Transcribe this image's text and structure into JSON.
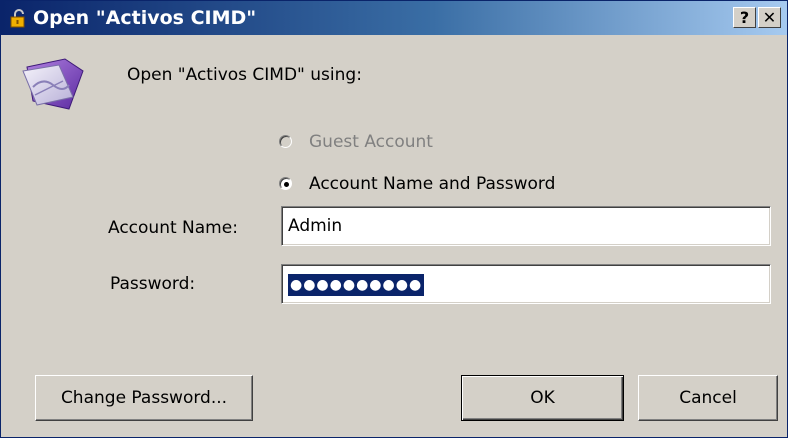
{
  "window": {
    "title": "Open \"Activos CIMD\"",
    "help_label": "?",
    "close_label": "✕"
  },
  "dialog": {
    "prompt": "Open \"Activos CIMD\" using:",
    "options": {
      "guest": {
        "label": "Guest Account",
        "selected": false,
        "enabled": false
      },
      "account": {
        "label": "Account Name and Password",
        "selected": true,
        "enabled": true
      }
    },
    "account_name": {
      "label": "Account Name:",
      "value": "Admin"
    },
    "password": {
      "label": "Password:",
      "value": "●●●●●●●●●●"
    }
  },
  "buttons": {
    "change_password": "Change Password...",
    "ok": "OK",
    "cancel": "Cancel"
  },
  "icons": {
    "title": "unlocked-padlock-icon",
    "app": "filemaker-app-icon"
  },
  "colors": {
    "titlebar_start": "#0a246a",
    "titlebar_end": "#a6caf0",
    "dialog_face": "#d4d0c8",
    "selection": "#0a246a"
  }
}
